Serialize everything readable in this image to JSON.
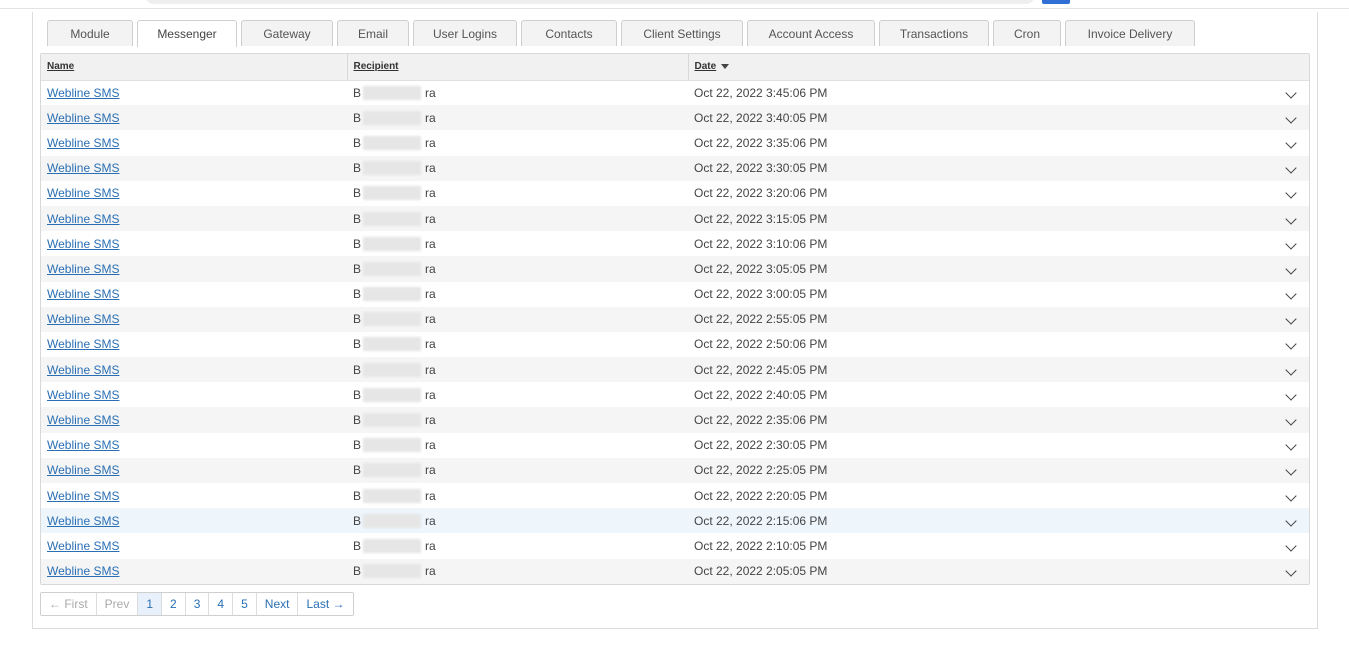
{
  "tabs": [
    {
      "label": "Module",
      "active": false
    },
    {
      "label": "Messenger",
      "active": true
    },
    {
      "label": "Gateway",
      "active": false
    },
    {
      "label": "Email",
      "active": false
    },
    {
      "label": "User Logins",
      "active": false
    },
    {
      "label": "Contacts",
      "active": false
    },
    {
      "label": "Client Settings",
      "active": false
    },
    {
      "label": "Account Access",
      "active": false
    },
    {
      "label": "Transactions",
      "active": false
    },
    {
      "label": "Cron",
      "active": false
    },
    {
      "label": "Invoice Delivery",
      "active": false
    }
  ],
  "table": {
    "headers": {
      "name": "Name",
      "recipient": "Recipient",
      "date": "Date"
    },
    "sort": {
      "column": "date",
      "direction": "desc"
    },
    "recipient_prefix": "B",
    "recipient_suffix": "ra",
    "rows": [
      {
        "name": "Webline SMS",
        "date": "Oct 22, 2022 3:45:06 PM"
      },
      {
        "name": "Webline SMS",
        "date": "Oct 22, 2022 3:40:05 PM"
      },
      {
        "name": "Webline SMS",
        "date": "Oct 22, 2022 3:35:06 PM"
      },
      {
        "name": "Webline SMS",
        "date": "Oct 22, 2022 3:30:05 PM"
      },
      {
        "name": "Webline SMS",
        "date": "Oct 22, 2022 3:20:06 PM"
      },
      {
        "name": "Webline SMS",
        "date": "Oct 22, 2022 3:15:05 PM"
      },
      {
        "name": "Webline SMS",
        "date": "Oct 22, 2022 3:10:06 PM"
      },
      {
        "name": "Webline SMS",
        "date": "Oct 22, 2022 3:05:05 PM"
      },
      {
        "name": "Webline SMS",
        "date": "Oct 22, 2022 3:00:05 PM"
      },
      {
        "name": "Webline SMS",
        "date": "Oct 22, 2022 2:55:05 PM"
      },
      {
        "name": "Webline SMS",
        "date": "Oct 22, 2022 2:50:06 PM"
      },
      {
        "name": "Webline SMS",
        "date": "Oct 22, 2022 2:45:05 PM"
      },
      {
        "name": "Webline SMS",
        "date": "Oct 22, 2022 2:40:05 PM"
      },
      {
        "name": "Webline SMS",
        "date": "Oct 22, 2022 2:35:06 PM"
      },
      {
        "name": "Webline SMS",
        "date": "Oct 22, 2022 2:30:05 PM"
      },
      {
        "name": "Webline SMS",
        "date": "Oct 22, 2022 2:25:05 PM"
      },
      {
        "name": "Webline SMS",
        "date": "Oct 22, 2022 2:20:05 PM"
      },
      {
        "name": "Webline SMS",
        "date": "Oct 22, 2022 2:15:06 PM"
      },
      {
        "name": "Webline SMS",
        "date": "Oct 22, 2022 2:10:05 PM"
      },
      {
        "name": "Webline SMS",
        "date": "Oct 22, 2022 2:05:05 PM"
      }
    ],
    "highlighted_row": 17
  },
  "pagination": {
    "first": "← First",
    "prev": "Prev",
    "pages": [
      "1",
      "2",
      "3",
      "4",
      "5"
    ],
    "current_page": "1",
    "next": "Next",
    "last": "Last →"
  },
  "colors": {
    "link": "#2a6fb3",
    "highlight_row": "#eef6fc",
    "brand_badge": "#2f6fd6"
  }
}
